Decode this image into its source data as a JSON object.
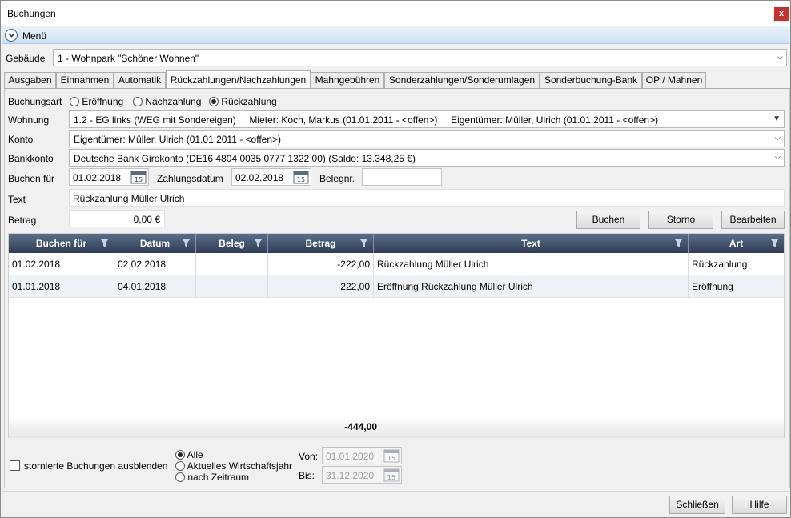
{
  "window": {
    "title": "Buchungen",
    "close_label": "x"
  },
  "menu": {
    "label": "Menü"
  },
  "building": {
    "label": "Gebäude",
    "value": "1 - Wohnpark \"Schöner Wohnen\""
  },
  "tabs": [
    {
      "label": "Ausgaben"
    },
    {
      "label": "Einnahmen"
    },
    {
      "label": "Automatik"
    },
    {
      "label": "Rückzahlungen/Nachzahlungen",
      "active": true
    },
    {
      "label": "Mahngebühren"
    },
    {
      "label": "Sonderzahlungen/Sonderumlagen"
    },
    {
      "label": "Sonderbuchung-Bank"
    },
    {
      "label": "OP / Mahnen"
    }
  ],
  "form": {
    "booking_type_label": "Buchungsart",
    "booking_types": [
      {
        "label": "Eröffnung",
        "selected": false
      },
      {
        "label": "Nachzahlung",
        "selected": false
      },
      {
        "label": "Rückzahlung",
        "selected": true
      }
    ],
    "apartment_label": "Wohnung",
    "apartment_value": "1.2 - EG links (WEG mit Sondereigen)     Mieter: Koch, Markus (01.01.2011 - <offen>)     Eigentümer: Müller, Ulrich (01.01.2011 - <offen>)",
    "account_label": "Konto",
    "account_value": "Eigentümer: Müller, Ulrich (01.01.2011 - <offen>)",
    "bank_label": "Bankkonto",
    "bank_value": "Deutsche Bank Girokonto (DE16 4804 0035 0777 1322 00) (Saldo: 13.348,25 €)",
    "book_for_label": "Buchen für",
    "book_for_value": "01.02.2018",
    "payment_date_label": "Zahlungsdatum",
    "payment_date_value": "02.02.2018",
    "receipt_no_label": "Belegnr.",
    "receipt_no_value": "",
    "text_label": "Text",
    "text_value": "Rückzahlung Müller Ulrich",
    "amount_label": "Betrag",
    "amount_value": "0,00 €",
    "calendar_day": "15"
  },
  "actions": {
    "book": "Buchen",
    "cancel": "Storno",
    "edit": "Bearbeiten"
  },
  "grid": {
    "columns": [
      "Buchen für",
      "Datum",
      "Beleg",
      "Betrag",
      "Text",
      "Art"
    ],
    "rows": [
      {
        "booked_for": "01.02.2018",
        "date": "02.02.2018",
        "receipt": "",
        "amount": "-222,00",
        "text": "Rückzahlung Müller Ulrich",
        "type": "Rückzahlung"
      },
      {
        "booked_for": "01.01.2018",
        "date": "04.01.2018",
        "receipt": "",
        "amount": "222,00",
        "text": "Eröffnung Rückzahlung Müller Ulrich",
        "type": "Eröffnung"
      }
    ],
    "total": "-444,00"
  },
  "filter": {
    "hide_cancelled_label": "stornierte Buchungen ausblenden",
    "hide_cancelled_checked": false,
    "period_options": [
      {
        "label": "Alle",
        "selected": true
      },
      {
        "label": "Aktuelles Wirtschaftsjahr",
        "selected": false
      },
      {
        "label": "nach Zeitraum",
        "selected": false
      }
    ],
    "from_label": "Von:",
    "from_value": "01.01.2020",
    "to_label": "Bis:",
    "to_value": "31.12.2020"
  },
  "footer": {
    "close": "Schließen",
    "help": "Hilfe"
  }
}
